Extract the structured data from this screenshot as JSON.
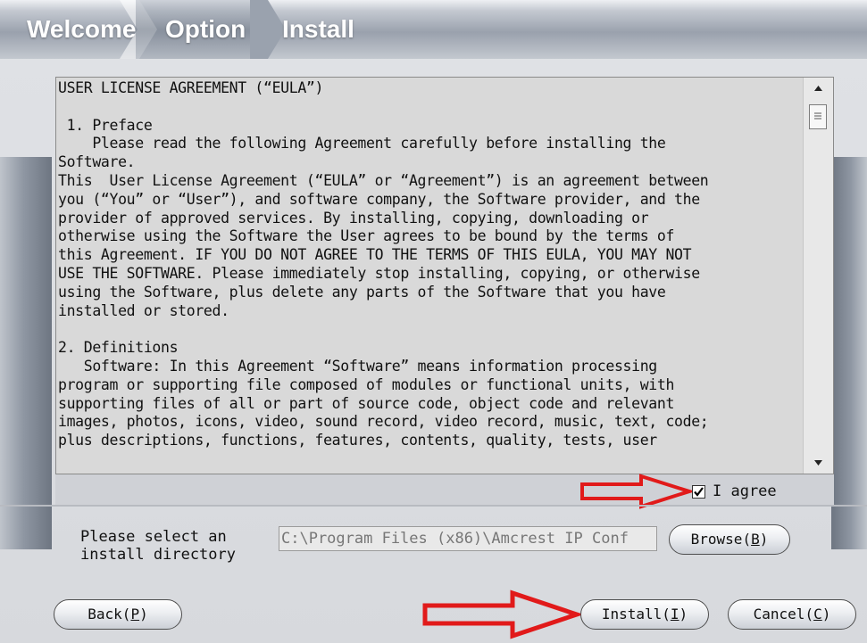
{
  "steps": [
    "Welcome",
    "Option",
    "Install"
  ],
  "eula": {
    "lines": [
      "USER LICENSE AGREEMENT (“EULA”)",
      "",
      " 1. Preface",
      "    Please read the following Agreement carefully before installing the",
      "Software.",
      "This  User License Agreement (“EULA” or “Agreement”) is an agreement between",
      "you (“You” or “User”), and software company, the Software provider, and the",
      "provider of approved services. By installing, copying, downloading or",
      "otherwise using the Software the User agrees to be bound by the terms of",
      "this Agreement. IF YOU DO NOT AGREE TO THE TERMS OF THIS EULA, YOU MAY NOT",
      "USE THE SOFTWARE. Please immediately stop installing, copying, or otherwise",
      "using the Software, plus delete any parts of the Software that you have",
      "installed or stored.",
      "",
      "2. Definitions",
      "   Software: In this Agreement “Software” means information processing",
      "program or supporting file composed of modules or functional units, with",
      "supporting files of all or part of source code, object code and relevant",
      "images, photos, icons, video, sound record, video record, music, text, code;",
      "plus descriptions, functions, features, contents, quality, tests, user"
    ]
  },
  "agree": {
    "label": "I agree",
    "checked": true
  },
  "directory": {
    "label": "Please select an\ninstall directory",
    "value": "C:\\Program Files (x86)\\Amcrest IP Conf"
  },
  "buttons": {
    "browse": {
      "text": "Browse(",
      "key": "B",
      "end": ")"
    },
    "back": {
      "text": "Back(",
      "key": "P",
      "end": ")"
    },
    "install": {
      "text": "Install(",
      "key": "I",
      "end": ")"
    },
    "cancel": {
      "text": "Cancel(",
      "key": "C",
      "end": ")"
    }
  },
  "colors": {
    "annotation_arrow": "#e11a1a",
    "steps_text": "#ffffff"
  }
}
